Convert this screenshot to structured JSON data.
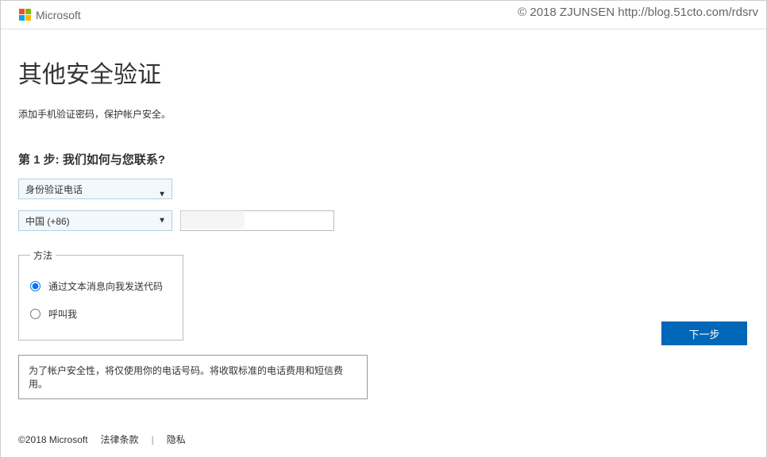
{
  "watermark": "© 2018 ZJUNSEN http://blog.51cto.com/rdsrv",
  "header": {
    "brand": "Microsoft"
  },
  "page": {
    "title": "其他安全验证",
    "subtitle": "添加手机验证密码，保护帐户安全。",
    "step_title": "第 1 步: 我们如何与您联系?",
    "contact_method": {
      "selected": "身份验证电话"
    },
    "country": {
      "selected": "中国 (+86)"
    },
    "phone_value": "",
    "method": {
      "legend": "方法",
      "option_sms": "通过文本消息向我发送代码",
      "option_call": "呼叫我"
    },
    "next_button": "下一步",
    "notice": "为了帐户安全性，将仅使用你的电话号码。将收取标准的电话费用和短信费用。"
  },
  "footer": {
    "copyright": "©2018 Microsoft",
    "legal": "法律条款",
    "privacy": "隐私"
  }
}
